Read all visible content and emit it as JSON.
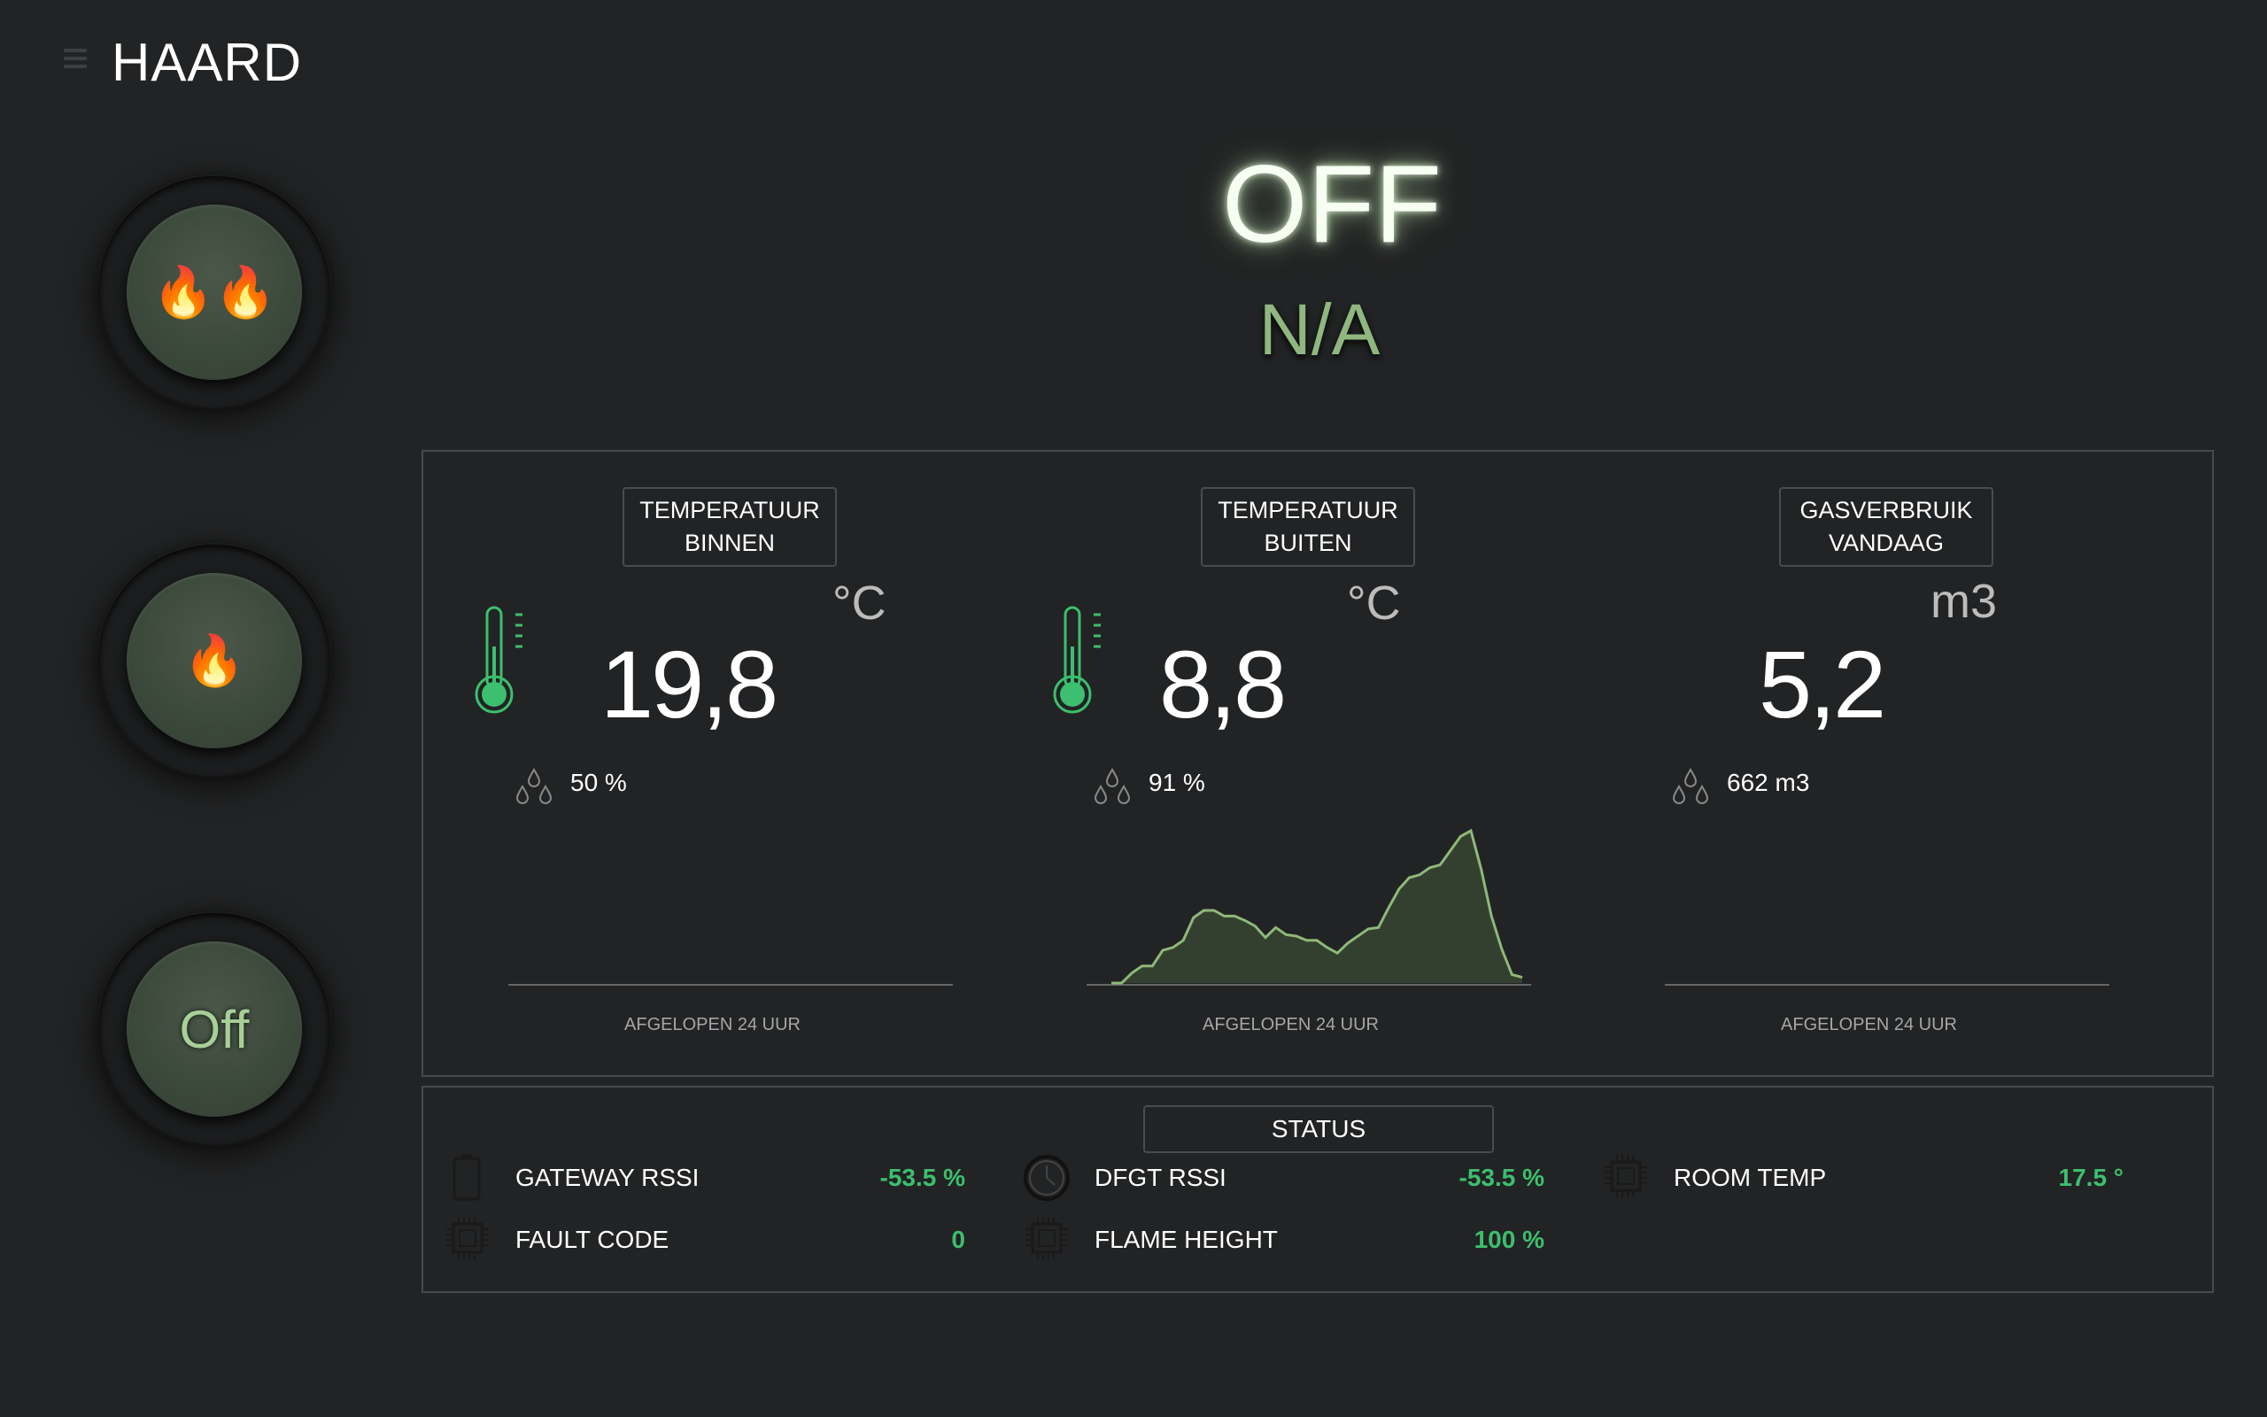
{
  "header": {
    "title": "HAARD"
  },
  "controls": [
    {
      "label": "🔥🔥",
      "kind": "flames-high"
    },
    {
      "label": "🔥",
      "kind": "flames-low"
    },
    {
      "label": "Off",
      "kind": "off"
    }
  ],
  "state": {
    "status": "OFF",
    "substatus": "N/A"
  },
  "sensors": [
    {
      "title_line1": "TEMPERATUUR",
      "title_line2": "BINNEN",
      "value": "19,8",
      "unit": "°C",
      "secondary": "50 %",
      "icon": "thermometer-icon",
      "caption": "AFGELOPEN 24 UUR",
      "chart_data": {
        "type": "area",
        "values": []
      }
    },
    {
      "title_line1": "TEMPERATUUR",
      "title_line2": "BUITEN",
      "value": "8,8",
      "unit": "°C",
      "secondary": "91 %",
      "icon": "thermometer-icon",
      "caption": "AFGELOPEN 24 UUR",
      "chart_data": {
        "type": "area",
        "values": [
          0,
          0,
          0.7,
          1.2,
          1.2,
          2.3,
          2.5,
          3.0,
          4.6,
          5.1,
          5.1,
          4.7,
          4.7,
          4.4,
          4.0,
          3.2,
          3.9,
          3.4,
          3.3,
          3.0,
          3.0,
          2.5,
          2.1,
          2.8,
          3.3,
          3.8,
          3.9,
          5.3,
          6.6,
          7.4,
          7.6,
          8.1,
          8.3,
          9.3,
          10.3,
          10.7,
          8.0,
          4.7,
          2.4,
          0.6,
          0.4
        ]
      }
    },
    {
      "title_line1": "GASVERBRUIK",
      "title_line2": "VANDAAG",
      "value": "5,2",
      "unit": "m3",
      "secondary": "662 m3",
      "icon": "",
      "caption": "AFGELOPEN 24 UUR",
      "chart_data": {
        "type": "area",
        "values": []
      }
    }
  ],
  "status": {
    "title": "STATUS",
    "items": [
      {
        "label": "GATEWAY RSSI",
        "value": "-53.5 %",
        "icon": "battery-icon"
      },
      {
        "label": "DFGT RSSI",
        "value": "-53.5 %",
        "icon": "clock-icon"
      },
      {
        "label": "ROOM TEMP",
        "value": "17.5 °",
        "icon": "chip-icon"
      },
      {
        "label": "FAULT CODE",
        "value": "0",
        "icon": "chip-icon"
      },
      {
        "label": "FLAME HEIGHT",
        "value": "100 %",
        "icon": "chip-icon"
      }
    ]
  },
  "colors": {
    "background": "#222324",
    "accent_green": "#3cbf6e",
    "chart_line": "#8fb87a",
    "chart_fill": "#34402f"
  }
}
